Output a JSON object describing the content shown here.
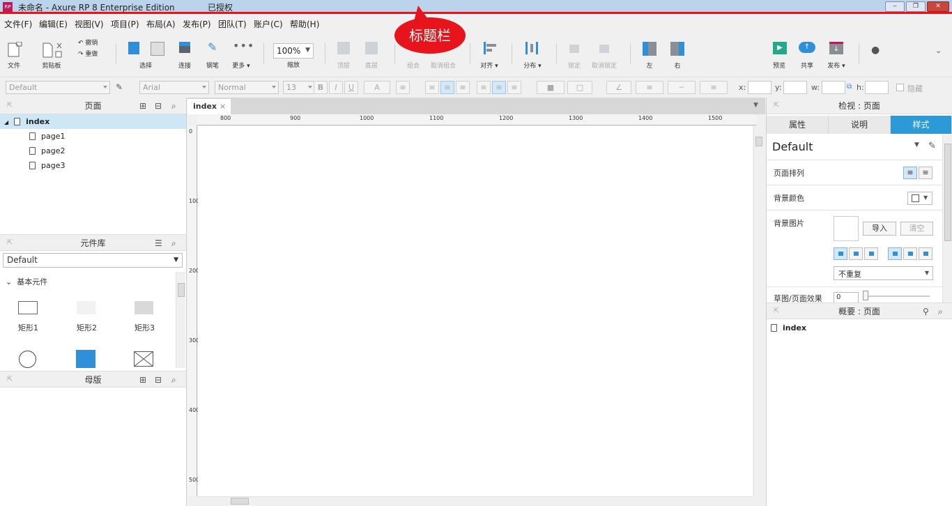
{
  "titlebar": {
    "logo": "RP",
    "title": "未命名 - Axure RP 8 Enterprise Edition",
    "license": "已授权",
    "minimize": "‒",
    "restore": "❐",
    "close": "✕"
  },
  "callout": {
    "text": "标题栏"
  },
  "menu": [
    "文件(F)",
    "编辑(E)",
    "视图(V)",
    "项目(P)",
    "布局(A)",
    "发布(P)",
    "团队(T)",
    "账户(C)",
    "帮助(H)"
  ],
  "toolbar": {
    "file": "文件",
    "clipboard": "剪贴板",
    "undo": "撤销",
    "redo": "重做",
    "select": "选择",
    "connect": "连接",
    "pen": "钢笔",
    "more": "更多 ▾",
    "zoom_value": "100%",
    "zoom": "缩放",
    "top": "顶层",
    "bottom": "底层",
    "group": "组合",
    "ungroup": "取消组合",
    "align": "对齐 ▾",
    "distribute": "分布 ▾",
    "lock": "锁定",
    "unlock": "取消锁定",
    "left": "左",
    "right": "右",
    "preview": "预览",
    "share": "共享",
    "publish": "发布 ▾"
  },
  "format": {
    "style": "Default",
    "font": "Arial",
    "weight": "Normal",
    "size": "13",
    "bold": "B",
    "italic": "I",
    "underline": "U",
    "font_color": "A",
    "x_label": "x:",
    "y_label": "y:",
    "w_label": "w:",
    "h_label": "h:",
    "hidden": "隐藏"
  },
  "pages_panel": {
    "title": "页面",
    "root": "index",
    "children": [
      "page1",
      "page2",
      "page3"
    ]
  },
  "library_panel": {
    "title": "元件库",
    "selected": "Default",
    "section": "基本元件",
    "items": [
      "矩形1",
      "矩形2",
      "矩形3"
    ]
  },
  "masters_panel": {
    "title": "母版"
  },
  "canvas": {
    "tab": "index",
    "tab_close": "×",
    "ruler_h": [
      "800",
      "900",
      "1000",
      "1100",
      "1200",
      "1300",
      "1400",
      "1500"
    ],
    "ruler_v": [
      "0",
      "100",
      "200",
      "300",
      "400",
      "500"
    ]
  },
  "inspector": {
    "title": "检视 : 页面",
    "tabs": [
      "属性",
      "说明",
      "样式"
    ],
    "style_name": "Default",
    "layout": "页面排列",
    "bg_color": "背景颜色",
    "bg_image": "背景图片",
    "import": "导入",
    "clear": "清空",
    "repeat": "不重复",
    "sketch": "草图/页面效果",
    "sketch_value": "0"
  },
  "outline": {
    "title": "概要 : 页面",
    "item": "index"
  }
}
